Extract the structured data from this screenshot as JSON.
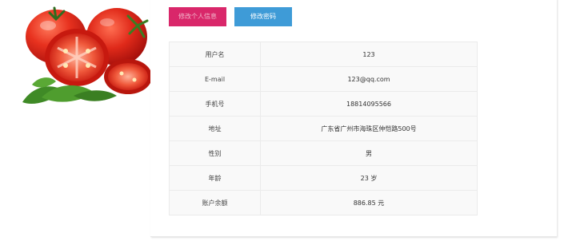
{
  "buttons": {
    "edit_profile": "修改个人信息",
    "change_password": "修改密码"
  },
  "profile": {
    "rows": [
      {
        "label": "用户名",
        "value": "123"
      },
      {
        "label": "E-mail",
        "value": "123@qq.com"
      },
      {
        "label": "手机号",
        "value": "18814095566"
      },
      {
        "label": "地址",
        "value": "广东省广州市海珠区仲恺路500号"
      },
      {
        "label": "性别",
        "value": "男"
      },
      {
        "label": "年龄",
        "value": "23 岁"
      },
      {
        "label": "账户余额",
        "value": "886.85 元"
      }
    ]
  },
  "colors": {
    "edit_button": "#d9276a",
    "password_button": "#3e9bd7",
    "table_background": "#f9f9f9",
    "tomato_red": "#e1261c",
    "leaf_green": "#4a8a2a"
  },
  "image": {
    "icon": "tomato-illustration"
  }
}
